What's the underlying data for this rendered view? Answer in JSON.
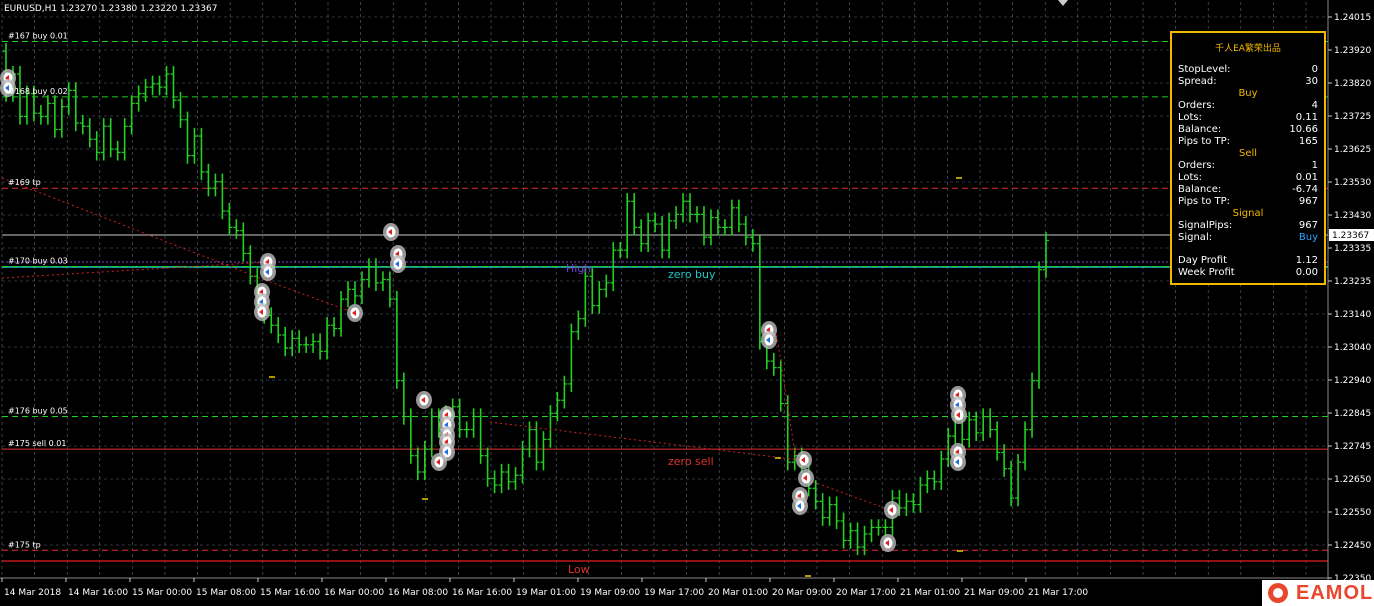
{
  "header": {
    "symbol_info": "EURUSD,H1  1.23270 1.23380 1.23220 1.23367"
  },
  "colors": {
    "bull": "#22d022",
    "grid": "#5a6a78",
    "panel_border": "#f5b800",
    "buy_blue": "#2aa7ff"
  },
  "price_axis": {
    "labels": [
      "1.24015",
      "1.23920",
      "1.23820",
      "1.23725",
      "1.23625",
      "1.23530",
      "1.23430",
      "1.23335",
      "1.23235",
      "1.23140",
      "1.23040",
      "1.22940",
      "1.22845",
      "1.22745",
      "1.22650",
      "1.22550",
      "1.22450",
      "1.22350"
    ],
    "current_price": "1.23367"
  },
  "time_axis": {
    "labels": [
      "14 Mar 2018",
      "14 Mar 16:00",
      "15 Mar 00:00",
      "15 Mar 08:00",
      "15 Mar 16:00",
      "16 Mar 00:00",
      "16 Mar 08:00",
      "16 Mar 16:00",
      "19 Mar 01:00",
      "19 Mar 09:00",
      "19 Mar 17:00",
      "20 Mar 01:00",
      "20 Mar 09:00",
      "20 Mar 17:00",
      "21 Mar 01:00",
      "21 Mar 09:00",
      "21 Mar 17:00"
    ]
  },
  "order_lines": [
    {
      "label": "#167 buy 0.01",
      "price": 1.2398,
      "color": "#22d022",
      "dash": true
    },
    {
      "label": "#168 buy 0.02",
      "price": 1.2381,
      "color": "#22d022",
      "dash": true
    },
    {
      "label": "#169 tp",
      "price": 1.2353,
      "color": "#e03030",
      "dash": true
    },
    {
      "label": "#170 buy 0.03",
      "price": 1.2329,
      "color": "#22d022",
      "dash": true
    },
    {
      "label": "#176 buy 0.05",
      "price": 1.2283,
      "color": "#22d022",
      "dash": true
    },
    {
      "label": "#175 sell 0.01",
      "price": 1.2273,
      "color": "#e03030",
      "dash": false
    },
    {
      "label": "#175 tp",
      "price": 1.2242,
      "color": "#e03030",
      "dash": true
    }
  ],
  "levels": {
    "high_label": "High",
    "zero_buy_label": "zero buy",
    "zero_sell_label": "zero sell",
    "low_label": "Low"
  },
  "chart_data": {
    "type": "bar",
    "ylim": [
      1.22335,
      1.24055
    ],
    "opens": [
      1.2395,
      1.2382,
      1.2388,
      1.2375,
      1.2382,
      1.2376,
      1.2375,
      1.2379,
      1.2371,
      1.2378,
      1.2383,
      1.2373,
      1.2372,
      1.2368,
      1.2364,
      1.2372,
      1.2365,
      1.2364,
      1.2372,
      1.2379,
      1.2382,
      1.2384,
      1.2385,
      1.2384,
      1.2388,
      1.238,
      1.2374,
      1.2363,
      1.2369,
      1.2358,
      1.2353,
      1.2355,
      1.2346,
      1.2341,
      1.234,
      1.2333,
      1.2326,
      1.2318,
      1.2314,
      1.2311,
      1.2308,
      1.2304,
      1.2307,
      1.2305,
      1.2305,
      1.2306,
      1.2303,
      1.2311,
      1.231,
      1.2319,
      1.2322,
      1.232,
      1.2325,
      1.2329,
      1.2324,
      1.2325,
      1.2319,
      1.2294,
      1.2283,
      1.2271,
      1.2266,
      1.2273,
      1.2283,
      1.2279,
      1.2284,
      1.2286,
      1.2279,
      1.2279,
      1.2283,
      1.2271,
      1.2264,
      1.2262,
      1.2266,
      1.2263,
      1.2265,
      1.2273,
      1.2279,
      1.2269,
      1.2276,
      1.2284,
      1.2288,
      1.2293,
      1.2309,
      1.2313,
      1.2326,
      1.2317,
      1.2322,
      1.2324,
      1.2334,
      1.2334,
      1.2349,
      1.2341,
      1.2336,
      1.2343,
      1.2342,
      1.2334,
      1.2343,
      1.2345,
      1.2349,
      1.2345,
      1.2345,
      1.2338,
      1.2344,
      1.2341,
      1.2341,
      1.2347,
      1.2342,
      1.2338,
      1.2336,
      1.2306,
      1.23,
      1.2298,
      1.2287,
      1.2269,
      1.2271,
      1.2268,
      1.2261,
      1.2257,
      1.2252,
      1.2256,
      1.2251,
      1.2245,
      1.2248,
      1.2243,
      1.2247,
      1.2249,
      1.2249,
      1.2249,
      1.2258,
      1.2255,
      1.2257,
      1.2256,
      1.2262,
      1.2264,
      1.2263,
      1.227,
      1.2277,
      1.2283,
      1.2276,
      1.2282,
      1.2278,
      1.2283,
      1.2279,
      1.2272,
      1.2267,
      1.2258,
      1.2269,
      1.2279,
      1.2294,
      1.2328
    ],
    "closes": [
      1.2382,
      1.2388,
      1.2375,
      1.2382,
      1.2376,
      1.2375,
      1.2379,
      1.2371,
      1.2378,
      1.2383,
      1.2373,
      1.2372,
      1.2368,
      1.2364,
      1.2372,
      1.2365,
      1.2364,
      1.2372,
      1.2379,
      1.2382,
      1.2384,
      1.2385,
      1.2384,
      1.2388,
      1.238,
      1.2374,
      1.2363,
      1.2369,
      1.2358,
      1.2353,
      1.2355,
      1.2346,
      1.2341,
      1.234,
      1.2333,
      1.2326,
      1.2318,
      1.2314,
      1.2311,
      1.2308,
      1.2304,
      1.2307,
      1.2305,
      1.2305,
      1.2306,
      1.2303,
      1.2311,
      1.231,
      1.2319,
      1.2322,
      1.232,
      1.2325,
      1.2329,
      1.2324,
      1.2325,
      1.2319,
      1.2294,
      1.2283,
      1.2271,
      1.2266,
      1.2273,
      1.2283,
      1.2279,
      1.2284,
      1.2286,
      1.2279,
      1.2279,
      1.2283,
      1.2271,
      1.2264,
      1.2262,
      1.2266,
      1.2263,
      1.2265,
      1.2273,
      1.2279,
      1.2269,
      1.2276,
      1.2284,
      1.2288,
      1.2293,
      1.2309,
      1.2313,
      1.2326,
      1.2317,
      1.2322,
      1.2324,
      1.2334,
      1.2334,
      1.2349,
      1.2341,
      1.2336,
      1.2343,
      1.2342,
      1.2334,
      1.2343,
      1.2345,
      1.2349,
      1.2345,
      1.2345,
      1.2338,
      1.2344,
      1.2341,
      1.2341,
      1.2347,
      1.2342,
      1.2338,
      1.2336,
      1.2306,
      1.23,
      1.2298,
      1.2287,
      1.2269,
      1.2271,
      1.2268,
      1.2261,
      1.2257,
      1.2252,
      1.2256,
      1.2251,
      1.2245,
      1.2248,
      1.2243,
      1.2247,
      1.2249,
      1.2249,
      1.2249,
      1.2258,
      1.2255,
      1.2257,
      1.2256,
      1.2262,
      1.2264,
      1.2263,
      1.227,
      1.2277,
      1.2283,
      1.2276,
      1.2282,
      1.2278,
      1.2283,
      1.2279,
      1.2272,
      1.2267,
      1.2258,
      1.2269,
      1.2279,
      1.2294,
      1.2328,
      1.2337
    ]
  },
  "panel": {
    "title": "千人EA繁荣出品",
    "stoplevel": {
      "label": "StopLevel:",
      "value": "0"
    },
    "spread": {
      "label": "Spread:",
      "value": "30"
    },
    "buy_header": "Buy",
    "buy_orders": {
      "label": "Orders:",
      "value": "4"
    },
    "buy_lots": {
      "label": "Lots:",
      "value": "0.11"
    },
    "buy_balance": {
      "label": "Balance:",
      "value": "10.66"
    },
    "buy_pips": {
      "label": "Pips to TP:",
      "value": "165"
    },
    "sell_header": "Sell",
    "sell_orders": {
      "label": "Orders:",
      "value": "1"
    },
    "sell_lots": {
      "label": "Lots:",
      "value": "0.01"
    },
    "sell_balance": {
      "label": "Balance:",
      "value": "-6.74"
    },
    "sell_pips": {
      "label": "Pips to TP:",
      "value": "967"
    },
    "signal_header": "Signal",
    "signal_pips": {
      "label": "SignalPips:",
      "value": "967"
    },
    "signal": {
      "label": "Signal:",
      "value": "Buy"
    },
    "day_profit": {
      "label": "Day Profit",
      "value": "1.12"
    },
    "week_profit": {
      "label": "Week Profit",
      "value": "0.00"
    }
  },
  "watermark": {
    "text": "EAMOL"
  }
}
